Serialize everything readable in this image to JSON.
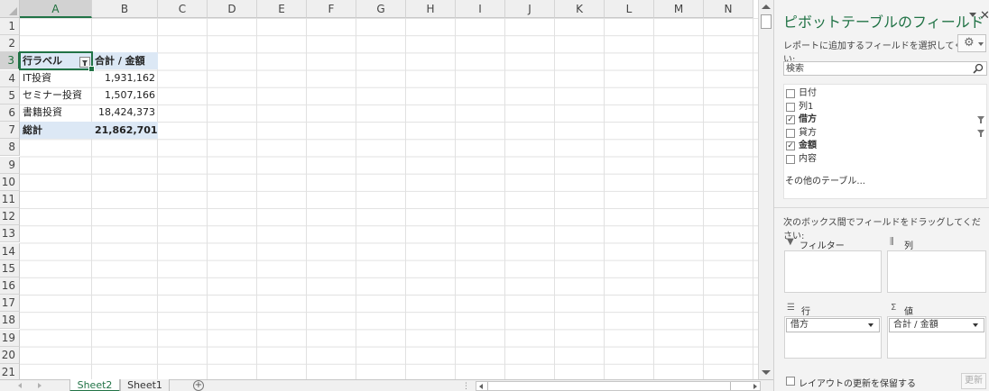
{
  "sheet": {
    "columns": [
      "A",
      "B",
      "C",
      "D",
      "E",
      "F",
      "G",
      "H",
      "I",
      "J",
      "K",
      "L",
      "M",
      "N"
    ],
    "rows": [
      "1",
      "2",
      "3",
      "4",
      "5",
      "6",
      "7",
      "8",
      "9",
      "10",
      "11",
      "12",
      "13",
      "14",
      "15",
      "16",
      "17",
      "18",
      "19",
      "20",
      "21"
    ],
    "selected_column": "A",
    "selected_row": "3",
    "pivot": {
      "header": [
        "行ラベル",
        "合計 / 金額"
      ],
      "rows": [
        [
          "IT投資",
          "1,931,162"
        ],
        [
          "セミナー投資",
          "1,507,166"
        ],
        [
          "書籍投資",
          "18,424,373"
        ]
      ],
      "total": [
        "総計",
        "21,862,701"
      ]
    }
  },
  "sheet_tabs": [
    "Sheet2",
    "Sheet1"
  ],
  "active_tab": "Sheet2",
  "pane": {
    "title": "ピボットテーブルのフィールド",
    "subtitle": "レポートに追加するフィールドを選択してください:",
    "search_placeholder": "検索",
    "fields": [
      {
        "label": "日付",
        "checked": false,
        "filtered": false
      },
      {
        "label": "列1",
        "checked": false,
        "filtered": false
      },
      {
        "label": "借方",
        "checked": true,
        "filtered": true
      },
      {
        "label": "貸方",
        "checked": false,
        "filtered": true
      },
      {
        "label": "金額",
        "checked": true,
        "filtered": false
      },
      {
        "label": "内容",
        "checked": false,
        "filtered": false
      }
    ],
    "more_tables": "その他のテーブル...",
    "drag_hint": "次のボックス間でフィールドをドラッグしてください:",
    "areas": {
      "filter_label": "フィルター",
      "columns_label": "列",
      "rows_label": "行",
      "values_label": "値",
      "rows_item": "借方",
      "values_item": "合計 / 金額"
    },
    "defer_label": "レイアウトの更新を保留する",
    "update_label": "更新"
  },
  "colors": {
    "accent": "#217346",
    "pivot_header": "#dce8f5"
  }
}
